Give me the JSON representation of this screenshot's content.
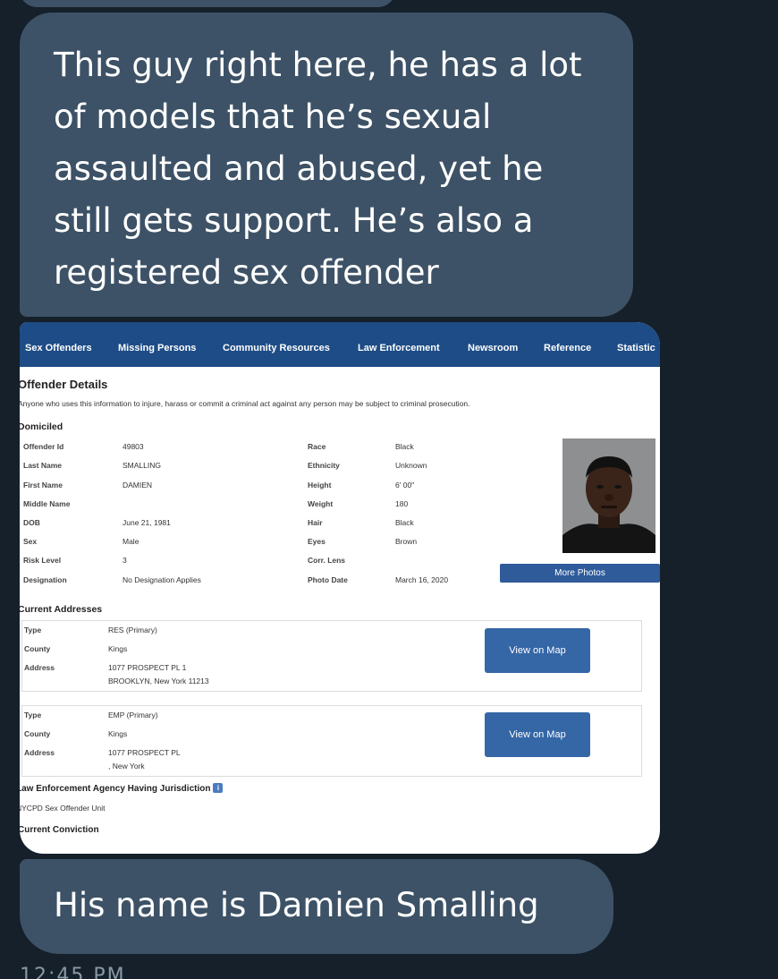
{
  "messages": {
    "first_text": "This guy right here, he has a lot of models that he’s sexual assaulted and abused, yet he still gets support. He’s also a registered sex offender",
    "second_text": "His name is Damien Smalling",
    "timestamp": "12:45 PM"
  },
  "screenshot": {
    "nav": [
      "Sex Offenders",
      "Missing Persons",
      "Community Resources",
      "Law Enforcement",
      "Newsroom",
      "Reference",
      "Statistic"
    ],
    "title": "Offender Details",
    "warning": "Anyone who uses this information to injure, harass or commit a criminal act against any person may be subject to criminal prosecution.",
    "domiciled_label": "Domiciled",
    "left_fields": [
      {
        "label": "Offender Id",
        "value": "49803"
      },
      {
        "label": "Last Name",
        "value": "SMALLING"
      },
      {
        "label": "First Name",
        "value": "DAMIEN"
      },
      {
        "label": "Middle Name",
        "value": ""
      },
      {
        "label": "DOB",
        "value": "June 21, 1981"
      },
      {
        "label": "Sex",
        "value": "Male"
      },
      {
        "label": "Risk Level",
        "value": "3"
      },
      {
        "label": "Designation",
        "value": "No Designation Applies"
      }
    ],
    "right_fields": [
      {
        "label": "Race",
        "value": "Black"
      },
      {
        "label": "Ethnicity",
        "value": "Unknown"
      },
      {
        "label": "Height",
        "value": "6' 00\""
      },
      {
        "label": "Weight",
        "value": "180"
      },
      {
        "label": "Hair",
        "value": "Black"
      },
      {
        "label": "Eyes",
        "value": "Brown"
      },
      {
        "label": "Corr. Lens",
        "value": ""
      },
      {
        "label": "Photo Date",
        "value": "March 16, 2020"
      }
    ],
    "more_photos": "More Photos",
    "current_addresses_label": "Current Addresses",
    "addresses": [
      {
        "type_label": "Type",
        "type": "RES (Primary)",
        "county_label": "County",
        "county": "Kings",
        "address_label": "Address",
        "line1": "1077 PROSPECT PL 1",
        "line2": "BROOKLYN, New York 11213",
        "map_button": "View on Map"
      },
      {
        "type_label": "Type",
        "type": "EMP (Primary)",
        "county_label": "County",
        "county": "Kings",
        "address_label": "Address",
        "line1": "1077 PROSPECT PL",
        "line2": ", New York",
        "map_button": "View on Map"
      }
    ],
    "jurisdiction_label": "Law Enforcement Agency Having Jurisdiction",
    "jurisdiction_value": "NYCPD Sex Offender Unit",
    "conviction_label": "Current Conviction"
  },
  "colors": {
    "background": "#15202b",
    "bubble": "#3d5266",
    "nav": "#1d4c86",
    "button": "#3566a6"
  }
}
